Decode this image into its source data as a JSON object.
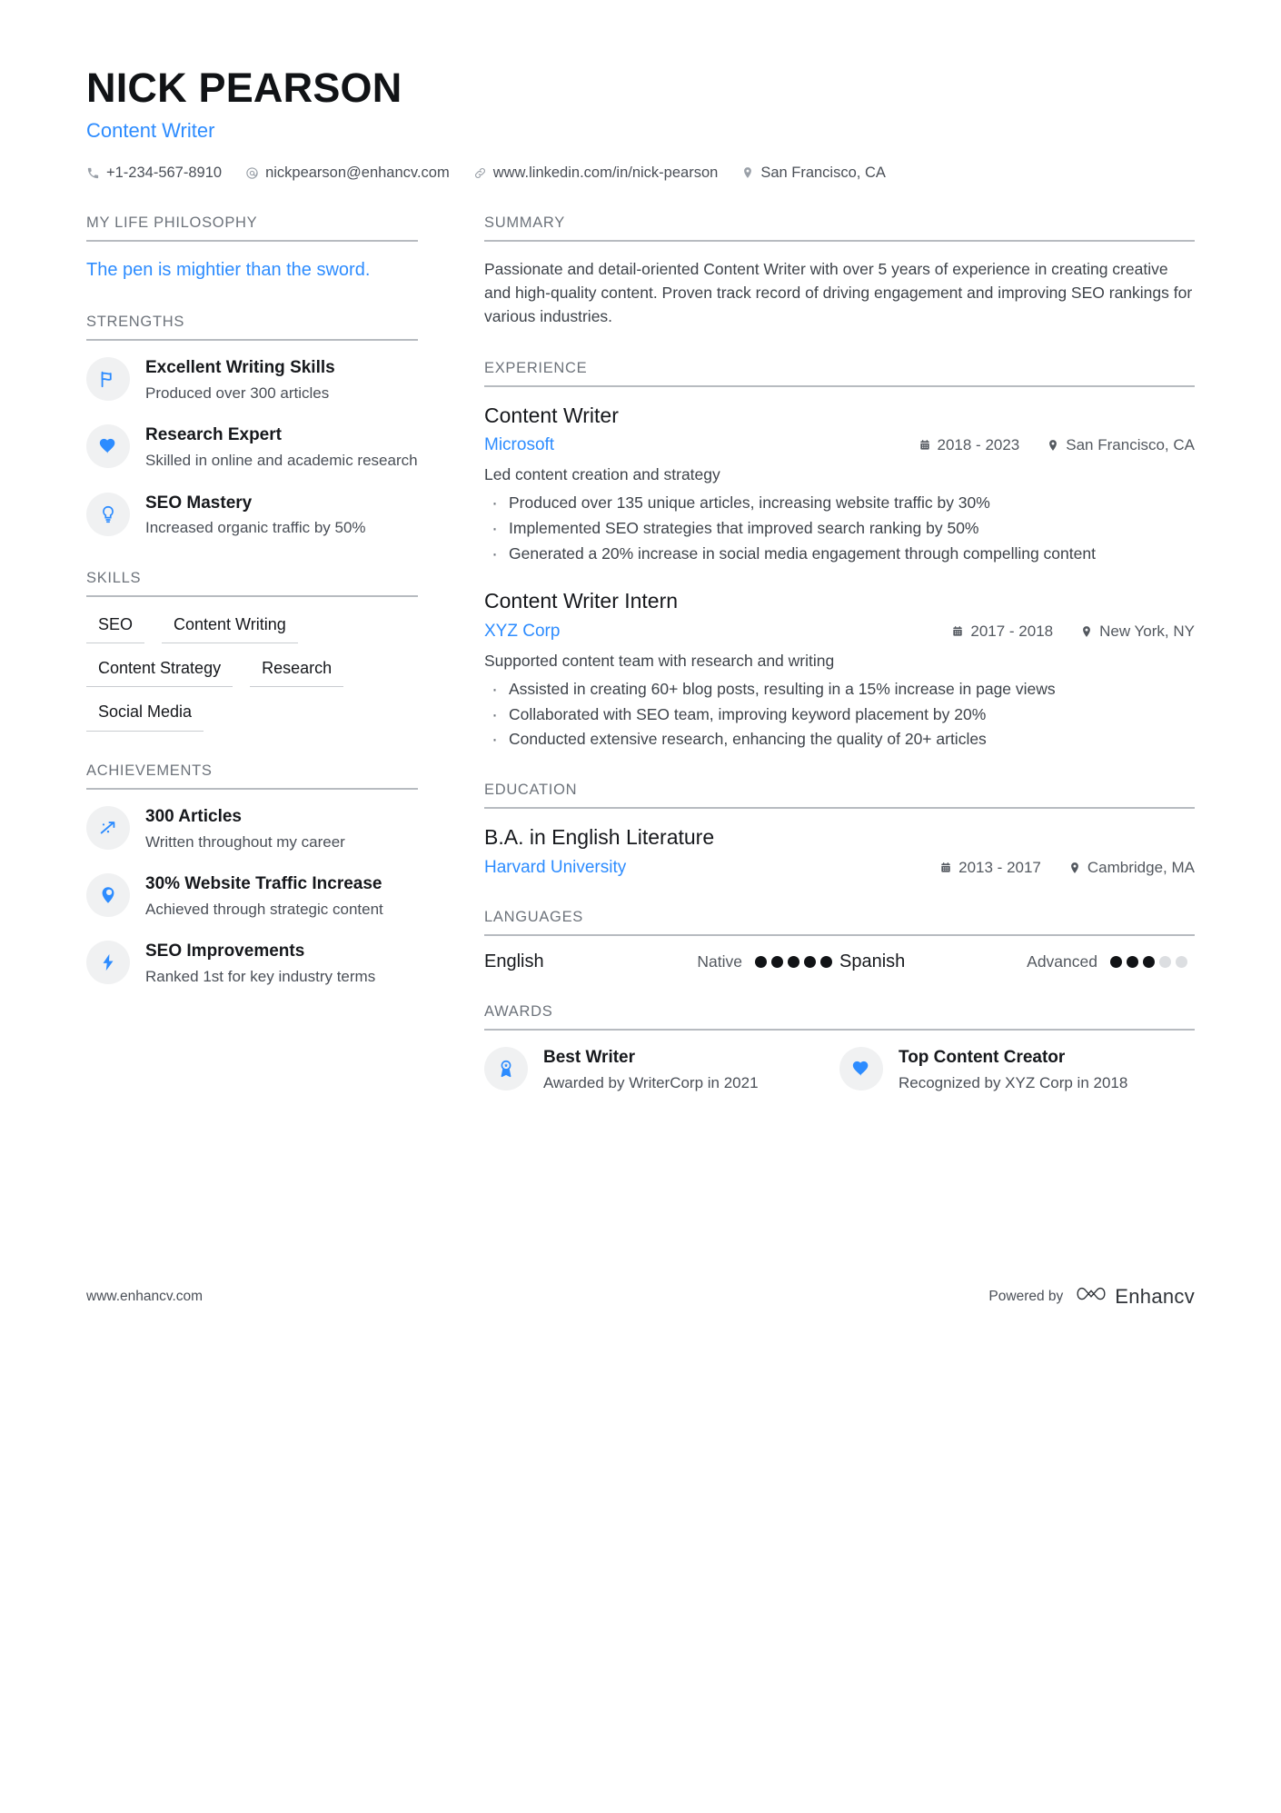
{
  "header": {
    "name": "NICK PEARSON",
    "role": "Content Writer",
    "contacts": [
      {
        "icon": "phone-icon",
        "text": "+1-234-567-8910"
      },
      {
        "icon": "email-icon",
        "text": "nickpearson@enhancv.com"
      },
      {
        "icon": "link-icon",
        "text": "www.linkedin.com/in/nick-pearson"
      },
      {
        "icon": "location-icon",
        "text": "San Francisco, CA"
      }
    ]
  },
  "left": {
    "philosophy": {
      "title": "MY LIFE PHILOSOPHY",
      "quote": "The pen is mightier than the sword."
    },
    "strengths": {
      "title": "STRENGTHS",
      "items": [
        {
          "icon": "flag-icon",
          "title": "Excellent Writing Skills",
          "desc": "Produced over 300 articles"
        },
        {
          "icon": "heart-icon",
          "title": "Research Expert",
          "desc": "Skilled in online and academic research"
        },
        {
          "icon": "lightbulb-icon",
          "title": "SEO Mastery",
          "desc": "Increased organic traffic by 50%"
        }
      ]
    },
    "skills": {
      "title": "SKILLS",
      "items": [
        "SEO",
        "Content Writing",
        "Content Strategy",
        "Research",
        "Social Media"
      ]
    },
    "achievements": {
      "title": "ACHIEVEMENTS",
      "items": [
        {
          "icon": "trend-up-icon",
          "title": "300 Articles",
          "desc": "Written throughout my career"
        },
        {
          "icon": "map-pin-icon",
          "title": "30% Website Traffic Increase",
          "desc": "Achieved through strategic content"
        },
        {
          "icon": "lightning-bolt-icon",
          "title": "SEO Improvements",
          "desc": "Ranked 1st for key industry terms"
        }
      ]
    }
  },
  "right": {
    "summary": {
      "title": "SUMMARY",
      "text": "Passionate and detail-oriented Content Writer with over 5 years of experience in creating creative and high-quality content. Proven track record of driving engagement and improving SEO rankings for various industries."
    },
    "experience": {
      "title": "EXPERIENCE",
      "entries": [
        {
          "role": "Content Writer",
          "org": "Microsoft",
          "dates": "2018 - 2023",
          "location": "San Francisco, CA",
          "sub": "Led content creation and strategy",
          "bullets": [
            "Produced over 135 unique articles, increasing website traffic by 30%",
            "Implemented SEO strategies that improved search ranking by 50%",
            "Generated a 20% increase in social media engagement through compelling content"
          ]
        },
        {
          "role": "Content Writer Intern",
          "org": "XYZ Corp",
          "dates": "2017 - 2018",
          "location": "New York, NY",
          "sub": "Supported content team with research and writing",
          "bullets": [
            "Assisted in creating 60+ blog posts, resulting in a 15% increase in page views",
            "Collaborated with SEO team, improving keyword placement by 20%",
            "Conducted extensive research, enhancing the quality of 20+ articles"
          ]
        }
      ]
    },
    "education": {
      "title": "EDUCATION",
      "entries": [
        {
          "degree": "B.A. in English Literature",
          "school": "Harvard University",
          "dates": "2013 - 2017",
          "location": "Cambridge, MA"
        }
      ]
    },
    "languages": {
      "title": "LANGUAGES",
      "items": [
        {
          "name": "English",
          "level": "Native",
          "filled": 5,
          "total": 5
        },
        {
          "name": "Spanish",
          "level": "Advanced",
          "filled": 3,
          "total": 5
        }
      ]
    },
    "awards": {
      "title": "AWARDS",
      "items": [
        {
          "icon": "ribbon-icon",
          "title": "Best Writer",
          "desc": "Awarded by WriterCorp in 2021"
        },
        {
          "icon": "heart-icon",
          "title": "Top Content Creator",
          "desc": "Recognized by XYZ Corp in 2018"
        }
      ]
    }
  },
  "footer": {
    "url": "www.enhancv.com",
    "powered_label": "Powered by",
    "brand": "Enhancv"
  },
  "colors": {
    "accent": "#2d8cff",
    "heading": "#6d737b",
    "rule": "#b7bbc0",
    "badge_bg": "#f0f1f2",
    "text": "#16181c",
    "muted": "#4a4f57",
    "dot_on": "#111316",
    "dot_off": "#dcdee1"
  }
}
